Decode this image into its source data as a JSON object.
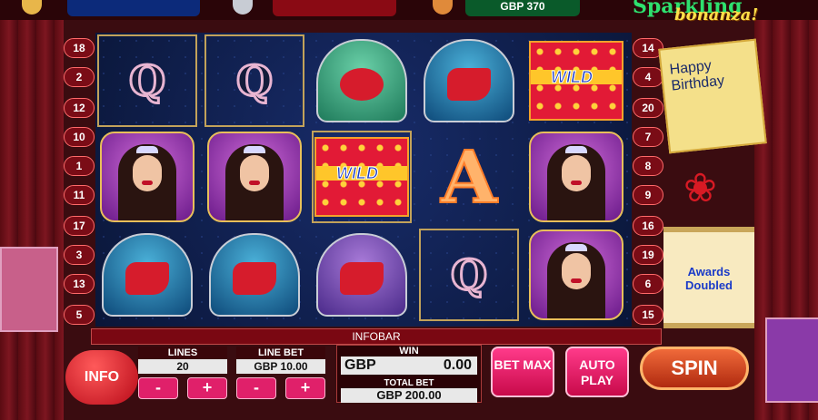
{
  "header": {
    "balance_partial": "GBP 370",
    "logo_word1": "Sparkling",
    "logo_word2": "bonanza!"
  },
  "reels": {
    "q_symbol": "Q",
    "a_symbol": "A",
    "wild_label": "WILD"
  },
  "paylines_left": [
    "18",
    "2",
    "12",
    "10",
    "1",
    "11",
    "17",
    "3",
    "13",
    "5"
  ],
  "paylines_right": [
    "14",
    "4",
    "20",
    "7",
    "8",
    "9",
    "16",
    "19",
    "6",
    "15"
  ],
  "card": {
    "text": "Happy Birthday"
  },
  "scroll": {
    "text": "Awards Doubled"
  },
  "infobar": {
    "label": "INFOBAR"
  },
  "controls": {
    "info_label": "INFO",
    "lines_label": "LINES",
    "lines_value": "20",
    "line_bet_label": "LINE BET",
    "line_bet_value": "GBP  10.00",
    "minus": "-",
    "plus": "+",
    "win_label": "WIN",
    "win_currency": "GBP",
    "win_value": "0.00",
    "total_bet_label": "TOTAL BET",
    "total_bet_value": "GBP  200.00",
    "bet_max_label": "BET MAX",
    "auto_play_label": "AUTO PLAY",
    "spin_label": "SPIN"
  },
  "colors": {
    "accent": "#e0206a",
    "reel_bg": "#182c6a",
    "frame_gold": "#c2a25a"
  }
}
